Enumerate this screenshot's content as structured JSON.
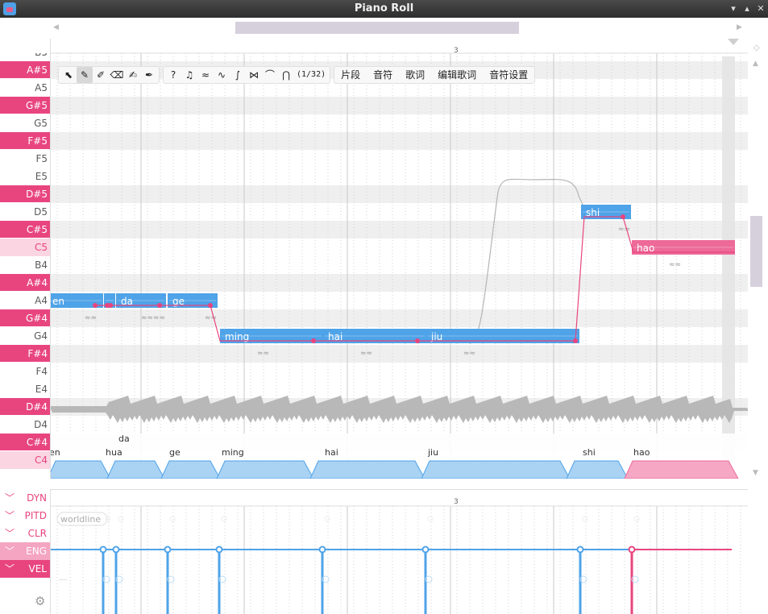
{
  "window": {
    "title": "Piano Roll"
  },
  "window_buttons": {
    "minimize": "▾",
    "maximize": "▴",
    "close": "✕"
  },
  "scroll": {
    "left_arrow": "◀",
    "right_arrow": "▶",
    "up_arrow": "▲",
    "down_arrow": "▼"
  },
  "bar_marker": "3",
  "keys": [
    {
      "label": "B5",
      "type": "white"
    },
    {
      "label": "A#5",
      "type": "black"
    },
    {
      "label": "A5",
      "type": "white"
    },
    {
      "label": "G#5",
      "type": "black"
    },
    {
      "label": "G5",
      "type": "white"
    },
    {
      "label": "F#5",
      "type": "black"
    },
    {
      "label": "F5",
      "type": "white"
    },
    {
      "label": "E5",
      "type": "white"
    },
    {
      "label": "D#5",
      "type": "black"
    },
    {
      "label": "D5",
      "type": "white"
    },
    {
      "label": "C#5",
      "type": "black"
    },
    {
      "label": "C5",
      "type": "hl"
    },
    {
      "label": "B4",
      "type": "white"
    },
    {
      "label": "A#4",
      "type": "black"
    },
    {
      "label": "A4",
      "type": "white"
    },
    {
      "label": "G#4",
      "type": "black"
    },
    {
      "label": "G4",
      "type": "white"
    },
    {
      "label": "F#4",
      "type": "black"
    },
    {
      "label": "F4",
      "type": "white"
    },
    {
      "label": "E4",
      "type": "white"
    },
    {
      "label": "D#4",
      "type": "black"
    },
    {
      "label": "D4",
      "type": "white"
    },
    {
      "label": "C#4",
      "type": "black"
    },
    {
      "label": "C4",
      "type": "hl"
    }
  ],
  "toolbar": {
    "tools": [
      {
        "name": "select-tool",
        "glyph": "⬉",
        "active": false
      },
      {
        "name": "pencil-tool",
        "glyph": "✎",
        "active": true
      },
      {
        "name": "magic-pencil-tool",
        "glyph": "✐",
        "active": false
      },
      {
        "name": "eraser-tool",
        "glyph": "⌫",
        "active": false
      },
      {
        "name": "brush-tool",
        "glyph": "✍",
        "active": false
      },
      {
        "name": "knife-tool",
        "glyph": "✒",
        "active": false
      }
    ],
    "tools2": [
      {
        "name": "question-tool",
        "glyph": "?"
      },
      {
        "name": "note-tool",
        "glyph": "♫"
      },
      {
        "name": "vibrato-tool",
        "glyph": "≈"
      },
      {
        "name": "pitch-curve-tool",
        "glyph": "∿"
      },
      {
        "name": "s-curve-tool",
        "glyph": "∫"
      },
      {
        "name": "waveform-tool",
        "glyph": "⋈"
      },
      {
        "name": "envelope-tool",
        "glyph": "⌒"
      },
      {
        "name": "phoneme-tool",
        "glyph": "⋂"
      }
    ],
    "snap": "(1/32)",
    "menu": [
      "片段",
      "音符",
      "歌词",
      "编辑歌词",
      "音符设置"
    ]
  },
  "notes": [
    {
      "lyric": "en",
      "pitch": "A4"
    },
    {
      "lyric": "hua",
      "pitch": "A4"
    },
    {
      "lyric": "da",
      "pitch": "A4"
    },
    {
      "lyric": "ge",
      "pitch": "A4"
    },
    {
      "lyric": "ming",
      "pitch": "G4"
    },
    {
      "lyric": "hai",
      "pitch": "G4"
    },
    {
      "lyric": "jiu",
      "pitch": "G4"
    },
    {
      "lyric": "shi",
      "pitch": "D5"
    },
    {
      "lyric": "hao",
      "pitch": "C5"
    }
  ],
  "phoneme_labels": [
    "en",
    "hua",
    "da",
    "ge",
    "ming",
    "hai",
    "jiu",
    "shi",
    "hao"
  ],
  "expressions": [
    {
      "label": "DYN",
      "state": "normal"
    },
    {
      "label": "PITD",
      "state": "normal"
    },
    {
      "label": "CLR",
      "state": "normal"
    },
    {
      "label": "ENG",
      "state": "semi"
    },
    {
      "label": "VEL",
      "state": "active"
    }
  ],
  "expression_badge": "worldline",
  "expression_small": "....",
  "colors": {
    "accent": "#e8457f",
    "note_blue": "#4fa3e8",
    "note_pink": "#ed6a98"
  }
}
